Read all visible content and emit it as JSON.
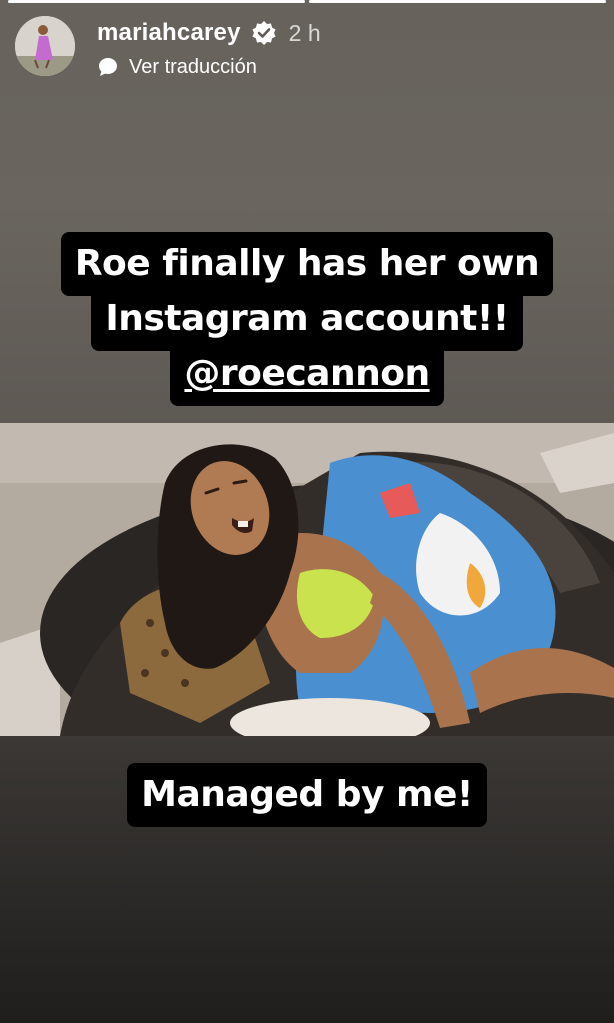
{
  "header": {
    "username": "mariahcarey",
    "time_ago": "2 h",
    "translate_label": "Ver traducción",
    "verified_icon": "verified-badge-icon",
    "translate_icon": "speech-bubble-icon"
  },
  "progress": {
    "segments": 2,
    "current_fill": 1.0
  },
  "caption": {
    "line1": "Roe finally has her own",
    "line2": "Instagram account!!",
    "mention": "@roecannon"
  },
  "bottom_caption": "Managed by me!",
  "colors": {
    "caption_bg": "#000000",
    "caption_text": "#ffffff",
    "background_top": "#67625c",
    "background_bottom": "#1f1e1c"
  }
}
